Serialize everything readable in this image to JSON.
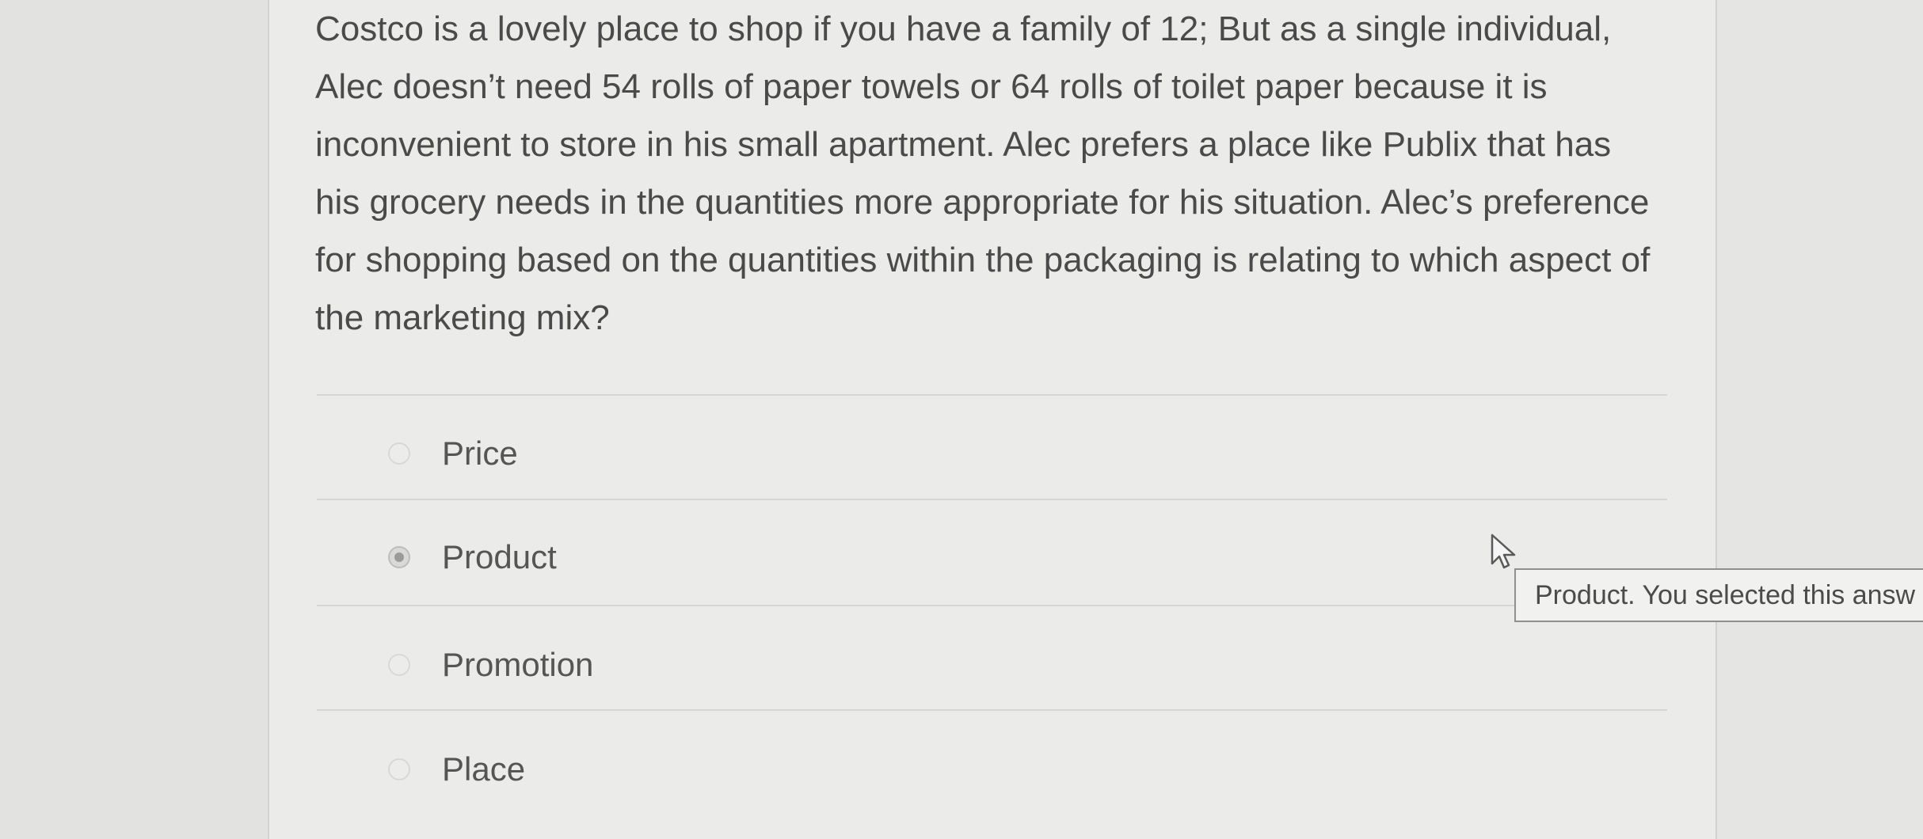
{
  "question": {
    "text": "Costco is a lovely place to shop if you have a family of 12; But as a single individual, Alec doesn’t need 54 rolls of paper towels or 64 rolls of toilet paper because it is inconvenient to store in his small apartment. Alec prefers a place like Publix that has his grocery needs in the quantities more appropriate for his situation. Alec’s preference for shopping based on the quantities within the packaging is relating to which aspect of the marketing mix?"
  },
  "options": [
    {
      "label": "Price",
      "selected": false
    },
    {
      "label": "Product",
      "selected": true
    },
    {
      "label": "Promotion",
      "selected": false
    },
    {
      "label": "Place",
      "selected": false
    }
  ],
  "tooltip": {
    "text": "Product. You selected this answ"
  },
  "icons": {
    "cursor": "arrow-pointer-icon",
    "radio": "radio-button-icon"
  }
}
